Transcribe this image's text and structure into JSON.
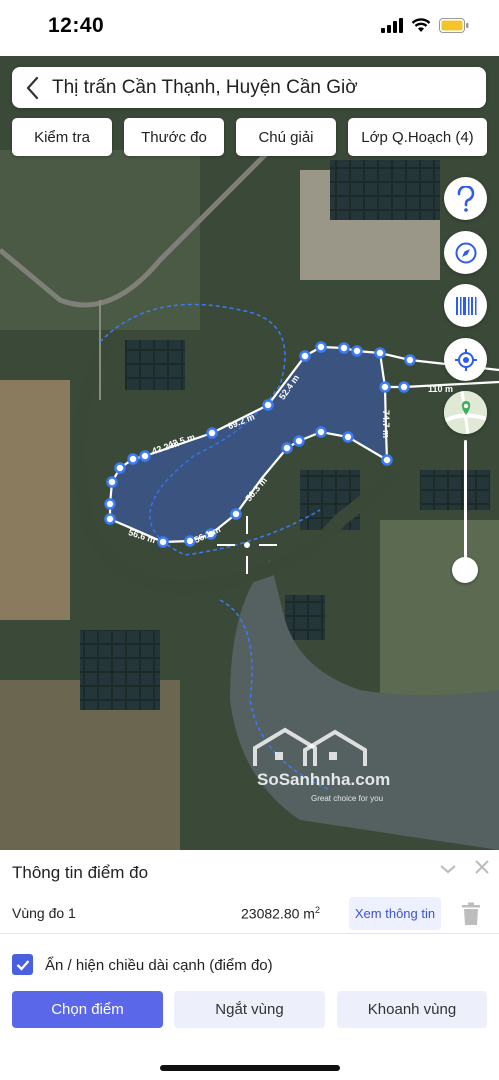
{
  "status_bar": {
    "time": "12:40"
  },
  "header": {
    "title": "Thị trấn Cần Thạnh, Huyện Cần Giờ"
  },
  "toolbar": {
    "check": "Kiểm tra",
    "measure": "Thước đo",
    "legend": "Chú giải",
    "layers": "Lớp Q.Hoạch (4)"
  },
  "map_controls": {
    "help_icon": "question-icon",
    "compass_icon": "compass-icon",
    "barcode_icon": "barcode-icon",
    "locate_icon": "locate-icon",
    "basemap_icon": "basemap-thumbnail",
    "zoom_level": 0.1
  },
  "measurements": {
    "edges": [
      "110 m",
      "52.4 m",
      "69.2 m",
      "42.2 m",
      "42.5 m",
      "56.6 m",
      "56.1 m",
      "56.3 m",
      "74.7 m"
    ]
  },
  "watermark": {
    "brand": "SoSanhnha.com",
    "tagline": "Great choice for you"
  },
  "panel": {
    "title": "Thông tin điểm đo",
    "area_name": "Vùng đo 1",
    "area_value": "23082.80 m",
    "area_unit_power": "2",
    "info_button": "Xem thông tin",
    "toggle_label": "Ẩn / hiện chiều dài cạnh (điểm đo)",
    "toggle_checked": true,
    "actions": {
      "select_point": "Chọn điểm",
      "break_area": "Ngắt vùng",
      "enclose_area": "Khoanh vùng"
    }
  },
  "colors": {
    "accent": "#4a5fe0",
    "polygon_stroke": "#3b7bf5",
    "polygon_fill": "#3a62d8",
    "secondary_bg": "#edf0fb"
  }
}
